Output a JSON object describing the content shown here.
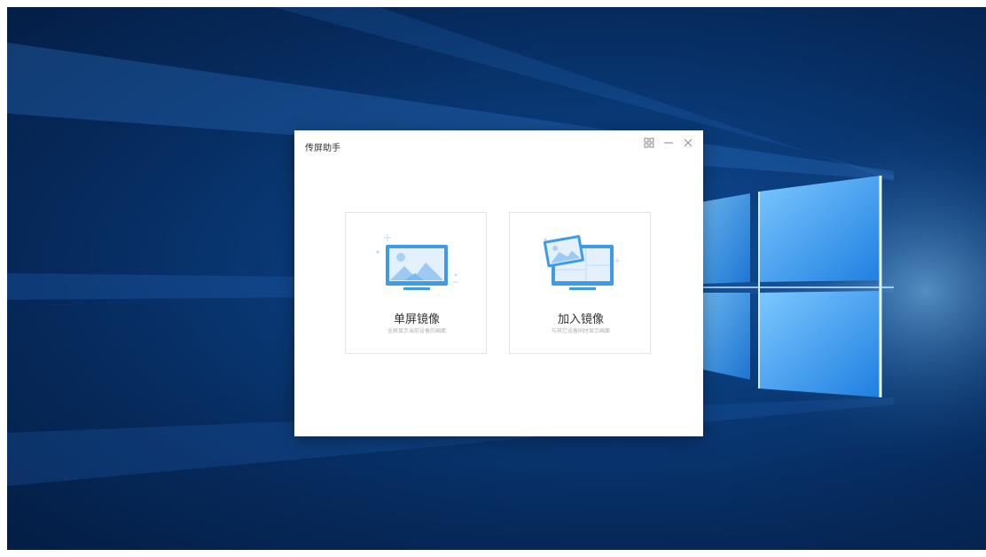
{
  "window": {
    "title": "传屏助手",
    "controls": {
      "grid_icon": "grid-icon",
      "minimize_icon": "minimize-icon",
      "close_icon": "close-icon"
    }
  },
  "cards": [
    {
      "title": "单屏镜像",
      "subtitle": "全屏显示当前设备的画面",
      "icon": "single-monitor-icon"
    },
    {
      "title": "加入镜像",
      "subtitle": "与其它设备同时显示画面",
      "icon": "multi-monitor-icon"
    }
  ],
  "colors": {
    "accent": "#3d9be9",
    "accent_light": "#cfe6fb",
    "desktop_blue": "#0a3a78"
  }
}
